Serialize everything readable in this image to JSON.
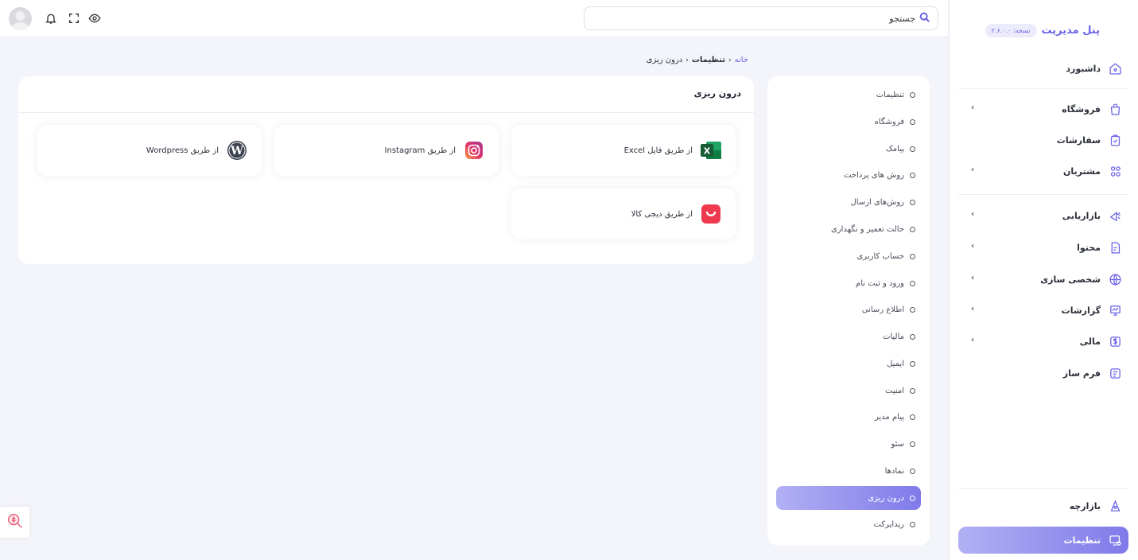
{
  "brand": {
    "title": "پنل مدیریت",
    "version": "نسخه: ۲.۶.۰.۰"
  },
  "sidebar": {
    "items": [
      {
        "label": "داشبورد",
        "icon": "home-icon"
      },
      {
        "label": "فروشگاه",
        "icon": "bag-icon"
      },
      {
        "label": "سفارشات",
        "icon": "order-bag-icon"
      },
      {
        "label": "مشتریان",
        "icon": "users-icon"
      },
      {
        "label": "بازاریابی",
        "icon": "megaphone-icon"
      },
      {
        "label": "محتوا",
        "icon": "document-icon"
      },
      {
        "label": "شخصی سازی",
        "icon": "globe-icon"
      },
      {
        "label": "گزارشات",
        "icon": "report-icon"
      },
      {
        "label": "مالی",
        "icon": "dollar-icon"
      },
      {
        "label": "فرم ساز",
        "icon": "form-icon"
      }
    ],
    "bottom": [
      {
        "label": "بازارچه",
        "icon": "market-icon"
      },
      {
        "label": "تنظیمات",
        "icon": "settings-icon"
      }
    ]
  },
  "header": {
    "search_placeholder": "جستجو"
  },
  "breadcrumb": {
    "home": "خانه",
    "middle": "تنظیمات",
    "current": "درون ریزی"
  },
  "settings_menu": [
    "تنظیمات",
    "فروشگاه",
    "پیامک",
    "روش های پرداخت",
    "روش‌های ارسال",
    "حالت تعمیر و نگهداری",
    "حساب کاربری",
    "ورود و ثبت نام",
    "اطلاع رسانی",
    "مالیات",
    "ایمیل",
    "امنیت",
    "پیام مدیر",
    "سئو",
    "نمادها",
    "درون ریزی",
    "ریدایرکت"
  ],
  "settings_active": "درون ریزی",
  "import": {
    "title": "درون ریزی",
    "options": [
      {
        "label": "از طریق فایل Excel",
        "icon": "excel-icon"
      },
      {
        "label": "از طریق Instagram",
        "icon": "instagram-icon"
      },
      {
        "label": "از طریق Wordpress",
        "icon": "wordpress-icon"
      },
      {
        "label": "از طریق دیجی کالا",
        "icon": "digikala-icon"
      }
    ]
  },
  "colors": {
    "accent": "#6b63e8",
    "gradient_start": "#b2b0f4",
    "gradient_end": "#7f7ae9"
  }
}
